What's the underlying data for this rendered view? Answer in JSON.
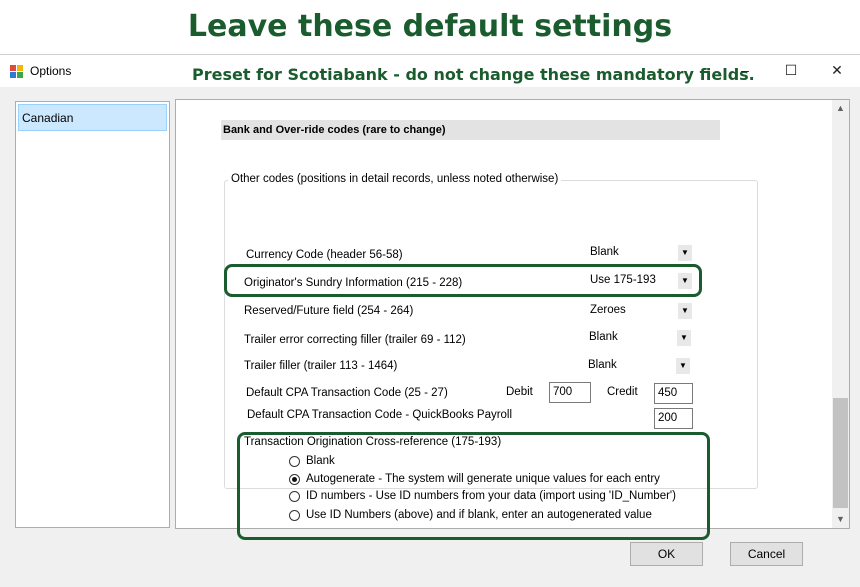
{
  "banner": {
    "title": "Leave these default settings"
  },
  "window": {
    "title": "Options",
    "preset_note": "Preset for Scotiabank - do not change these mandatory fields.",
    "controls": {
      "minimize": "–",
      "maximize": "☐",
      "close": "✕"
    }
  },
  "sidebar": {
    "items": [
      {
        "label": "Canadian"
      }
    ]
  },
  "section": {
    "header": "Bank and Over-ride codes (rare to change)"
  },
  "other_codes": {
    "title": "Other codes (positions in detail records, unless noted otherwise)",
    "rows": [
      {
        "label": "Currency Code (header 56-58)",
        "value": "Blank"
      },
      {
        "label": "Originator's Sundry Information (215 - 228)",
        "value": "Use 175-193"
      },
      {
        "label": "Reserved/Future field (254 - 264)",
        "value": "Zeroes"
      },
      {
        "label": "Trailer error correcting filler (trailer 69 - 112)",
        "value": "Blank"
      },
      {
        "label": "Trailer filler (trailer 113 - 1464)",
        "value": "Blank"
      }
    ],
    "cpa": {
      "label": "Default CPA Transaction Code (25 - 27)",
      "debit_label": "Debit",
      "debit_value": "700",
      "credit_label": "Credit",
      "credit_value": "450"
    },
    "cpa_payroll": {
      "label": "Default CPA Transaction Code - QuickBooks Payroll",
      "value": "200"
    }
  },
  "cross_reference": {
    "title": "Transaction Origination Cross-reference (175-193)",
    "options": [
      {
        "label": "Blank",
        "checked": false
      },
      {
        "label": "Autogenerate - The system will generate unique values for each entry",
        "checked": true
      },
      {
        "label": "ID numbers - Use ID numbers from your data (import using 'ID_Number')",
        "checked": false
      },
      {
        "label": "Use ID Numbers (above) and if blank, enter an autogenerated value",
        "checked": false
      }
    ]
  },
  "footer": {
    "ok_label": "OK",
    "cancel_label": "Cancel"
  },
  "icons": {
    "dropdown": "chevron-down-icon",
    "scroll_up": "chevron-up-icon",
    "scroll_down": "chevron-down-icon"
  },
  "colors": {
    "highlight": "#1a5c2e",
    "selection": "#cce8ff"
  }
}
